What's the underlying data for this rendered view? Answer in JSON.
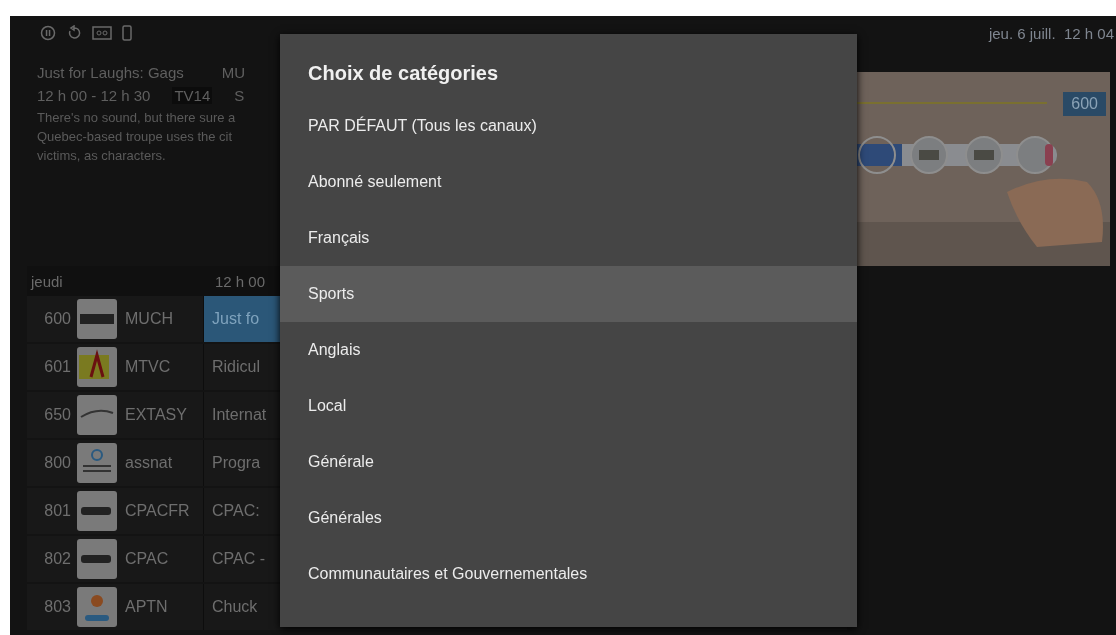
{
  "clock": "jeu. 6 juill.  12 h 04",
  "program": {
    "title": "Just for Laughs: Gags",
    "channel": "MU",
    "time": "12 h 00 - 12 h 30",
    "rating": "TV14",
    "extra": "S",
    "description": [
      "There's no sound, but there sure a",
      "Quebec-based troupe uses the cit",
      "victims, as characters."
    ]
  },
  "preview": {
    "kind": "picture",
    "channel_badge": "600"
  },
  "guide": {
    "day": "jeudi",
    "time_slot": "12 h 00",
    "rows": [
      {
        "number": "600",
        "name": "MUCH",
        "program": "Just fo",
        "selected": true
      },
      {
        "number": "601",
        "name": "MTVC",
        "program": "Ridicul",
        "selected": false
      },
      {
        "number": "650",
        "name": "EXTASY",
        "program": "Internat",
        "selected": false
      },
      {
        "number": "800",
        "name": "assnat",
        "program": "Progra",
        "selected": false
      },
      {
        "number": "801",
        "name": "CPACFR",
        "program": "CPAC:",
        "selected": false
      },
      {
        "number": "802",
        "name": "CPAC",
        "program": "CPAC -",
        "selected": false
      },
      {
        "number": "803",
        "name": "APTN",
        "program": "Chuck",
        "selected": false
      }
    ]
  },
  "dialog": {
    "title": "Choix de catégories",
    "items": [
      {
        "label": "PAR DÉFAUT (Tous les canaux)",
        "selected": false
      },
      {
        "label": "Abonné seulement",
        "selected": false
      },
      {
        "label": "Français",
        "selected": false
      },
      {
        "label": "Sports",
        "selected": true
      },
      {
        "label": "Anglais",
        "selected": false
      },
      {
        "label": "Local",
        "selected": false
      },
      {
        "label": "Générale",
        "selected": false
      },
      {
        "label": "Générales",
        "selected": false
      },
      {
        "label": "Communautaires et Gouvernementales",
        "selected": false
      }
    ]
  }
}
